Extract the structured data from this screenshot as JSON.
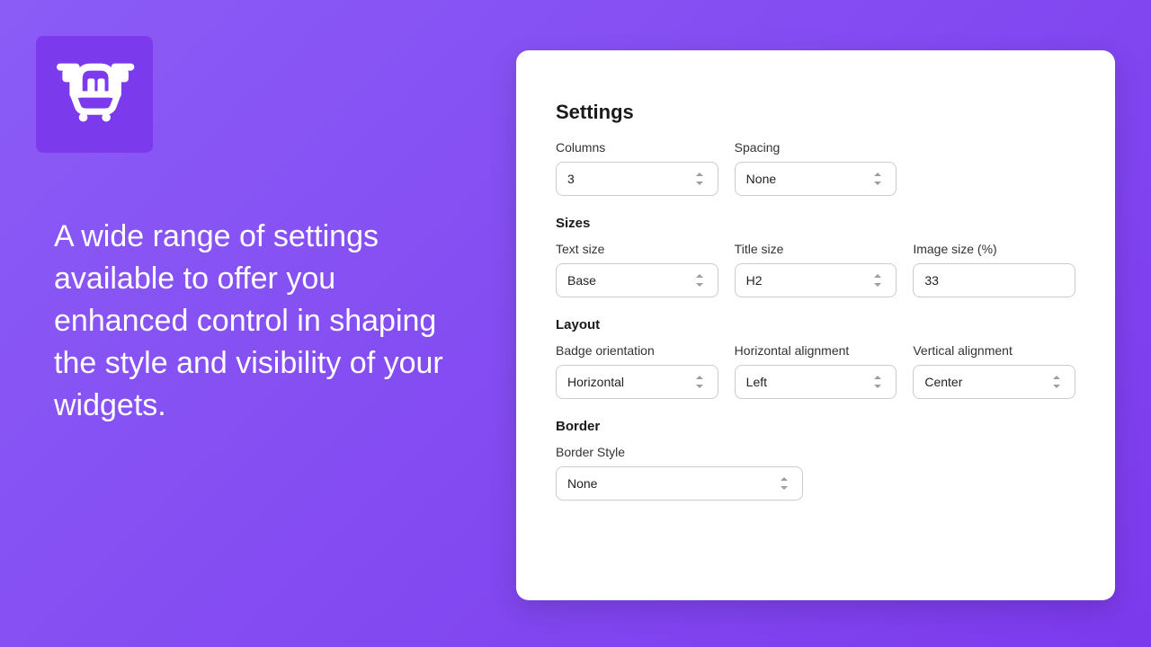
{
  "promo": {
    "text": "A wide range of settings available to offer you enhanced control in shaping the style and visibility of your widgets."
  },
  "panel": {
    "title": "Settings",
    "columns": {
      "label": "Columns",
      "value": "3"
    },
    "spacing": {
      "label": "Spacing",
      "value": "None"
    },
    "sizes_heading": "Sizes",
    "text_size": {
      "label": "Text size",
      "value": "Base"
    },
    "title_size": {
      "label": "Title size",
      "value": "H2"
    },
    "image_size": {
      "label": "Image size (%)",
      "value": "33"
    },
    "layout_heading": "Layout",
    "badge_orientation": {
      "label": "Badge orientation",
      "value": "Horizontal"
    },
    "h_align": {
      "label": "Horizontal alignment",
      "value": "Left"
    },
    "v_align": {
      "label": "Vertical alignment",
      "value": "Center"
    },
    "border_heading": "Border",
    "border_style": {
      "label": "Border Style",
      "value": "None"
    }
  }
}
